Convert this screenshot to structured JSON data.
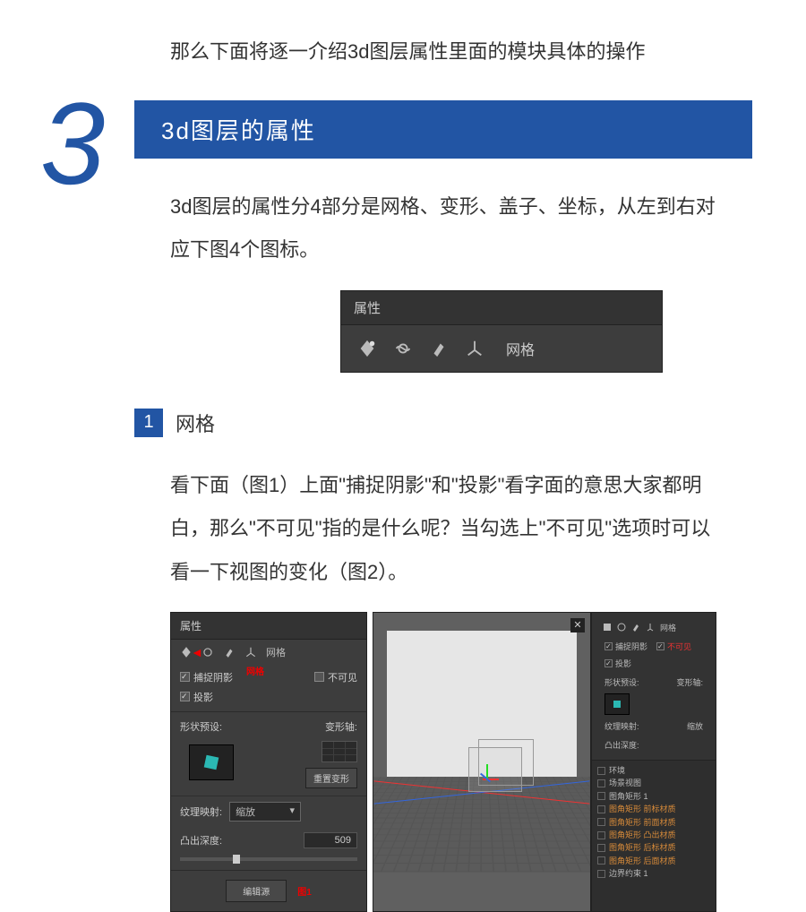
{
  "intro": "那么下面将逐一介绍3d图层属性里面的模块具体的操作",
  "section": {
    "number": "3",
    "title": "3d图层的属性"
  },
  "body1": "3d图层的属性分4部分是网格、变形、盖子、坐标，从左到右对应下图4个图标。",
  "panel1": {
    "title": "属性",
    "label": "网格"
  },
  "sub": {
    "num": "1",
    "title": "网格"
  },
  "body2": "看下面（图1）上面\"捕捉阴影\"和\"投影\"看字面的意思大家都明白，那么\"不可见\"指的是什么呢？当勾选上\"不可见\"选项时可以看一下视图的变化（图2）。",
  "fig1": {
    "title": "属性",
    "tab_label": "网格",
    "check_capture": "捕捉阴影",
    "check_cast": "投影",
    "check_invisible": "不可见",
    "red_label": "网格",
    "preset_label": "形状预设:",
    "axis_label": "变形轴:",
    "reset_btn": "重置变形",
    "texture_label": "纹理映射:",
    "texture_value": "缩放",
    "depth_label": "凸出深度:",
    "depth_value": "509",
    "edit_btn": "编辑源",
    "fig_label": "图1"
  },
  "fig2": {
    "panel_label": "网格",
    "check_capture": "捕捉阴影",
    "check_cast": "投影",
    "check_invisible": "不可见",
    "preset_label": "形状预设:",
    "axis_label": "变形轴:",
    "texture_label": "纹理映射:",
    "texture_value": "缩放",
    "depth_label": "凸出深度:",
    "list_header": "环境",
    "list_scene": "场景视图",
    "list_items": [
      "图角矩形 1",
      "图角矩形 前标材质",
      "图角矩形 前面材质",
      "图角矩形 凸出材质",
      "图角矩形 后标材质",
      "图角矩形 后面材质",
      "边界约束 1"
    ]
  }
}
